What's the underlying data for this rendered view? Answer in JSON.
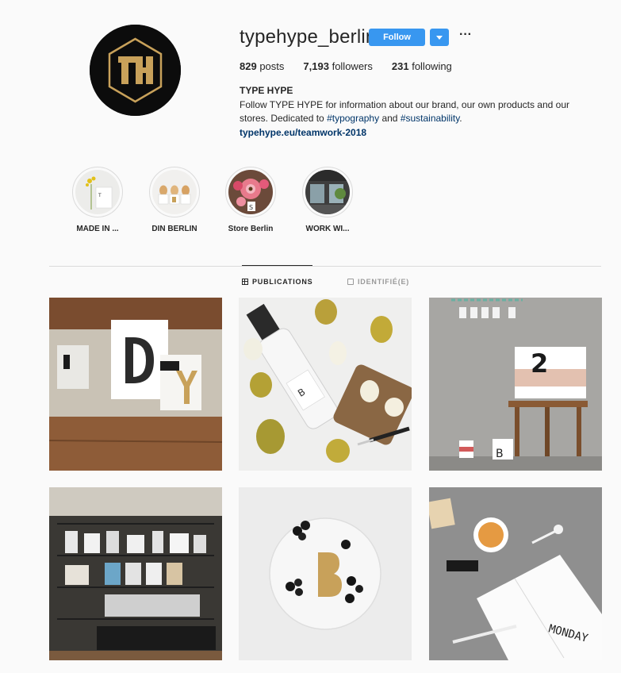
{
  "profile": {
    "username": "typehype_berlin",
    "follow_label": "Follow",
    "more_label": "···",
    "avatar_initials": "TH",
    "stats": {
      "posts_count": "829",
      "posts_label": "posts",
      "followers_count": "7,193",
      "followers_label": "followers",
      "following_count": "231",
      "following_label": "following"
    },
    "bio": {
      "name": "TYPE HYPE",
      "line1": "Follow TYPE HYPE for information about our brand, our own products and our",
      "line2_prefix": "stores. Dedicated to ",
      "hashtag1": "#typography",
      "and": " and ",
      "hashtag2": "#sustainability",
      "period": ".",
      "link": "typehype.eu/teamwork-2018"
    }
  },
  "highlights": [
    {
      "label": "MADE IN ...",
      "icon": "plant-card-thumbnail"
    },
    {
      "label": "DIN BERLIN",
      "icon": "egg-cups-thumbnail"
    },
    {
      "label": "Store Berlin",
      "icon": "flowers-thumbnail"
    },
    {
      "label": "WORK WI...",
      "icon": "store-front-thumbnail"
    }
  ],
  "tabs": {
    "publications": "PUBLICATIONS",
    "tagged": "IDENTIFIÉ(E)"
  },
  "posts": [
    {
      "subject": "letter-cups-wood"
    },
    {
      "subject": "pears-bottle"
    },
    {
      "subject": "stool-letter-2"
    },
    {
      "subject": "store-shelves"
    },
    {
      "subject": "plate-blackberries-b"
    },
    {
      "subject": "notebook-monday"
    }
  ],
  "post_text": {
    "monday": "MONDAY"
  },
  "colors": {
    "accent": "#3897f0",
    "link": "#003569",
    "avatar_bg": "#0c0c0c",
    "avatar_gold": "#c8a15a"
  }
}
